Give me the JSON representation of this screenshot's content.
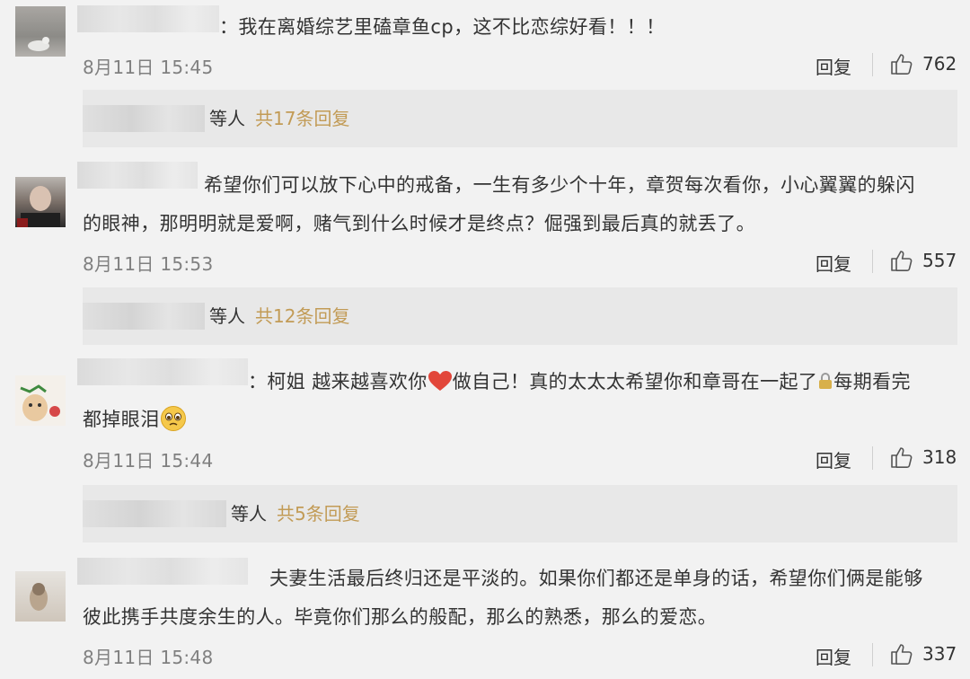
{
  "comments": [
    {
      "text_line1": "：我在离婚综艺里磕章鱼cp，这不比恋综好看！！！",
      "time": "8月11日 15:45",
      "reply_label": "回复",
      "likes": "762",
      "thread": {
        "deng": "等人",
        "count": "共17条回复"
      }
    },
    {
      "text_line1": "希望你们可以放下心中的戒备，一生有多少个十年，章贺每次看你，小心翼翼的躲闪",
      "text_line2": "的眼神，那明明就是爱啊，赌气到什么时候才是终点？倔强到最后真的就丢了。",
      "time": "8月11日 15:53",
      "reply_label": "回复",
      "likes": "557",
      "thread": {
        "deng": "等人",
        "count": "共12条回复"
      }
    },
    {
      "text_a": "：柯姐 越来越喜欢你",
      "text_b": "做自己！真的太太太希望你和章哥在一起了",
      "text_c": "每期看完",
      "text_line2": "都掉眼泪",
      "time": "8月11日 15:44",
      "reply_label": "回复",
      "likes": "318",
      "thread": {
        "deng": "等人",
        "count": "共5条回复"
      }
    },
    {
      "text_line1": "夫妻生活最后终归还是平淡的。如果你们都还是单身的话，希望你们俩是能够",
      "text_line2": "彼此携手共度余生的人。毕竟你们那么的般配，那么的熟悉，那么的爱恋。",
      "time": "8月11日 15:48",
      "reply_label": "回复",
      "likes": "337"
    }
  ],
  "colors": {
    "background": "#f2f2f2",
    "reply_box": "#e8e8e8",
    "reply_count": "#c29b56",
    "meta": "#808080"
  },
  "icons": [
    "thumbs-up-icon",
    "heart-emoji",
    "lock-emoji",
    "teary-face-emoji"
  ]
}
